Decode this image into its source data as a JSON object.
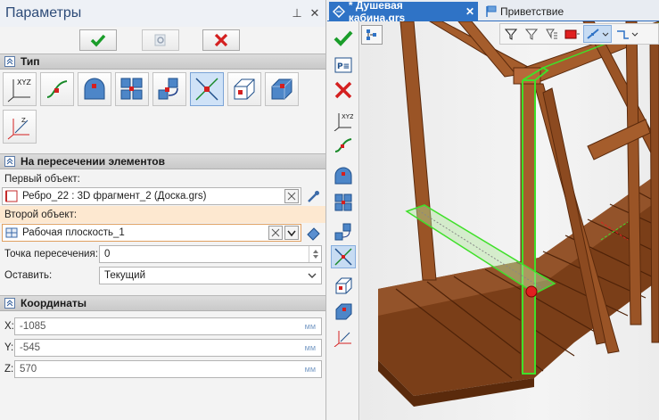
{
  "left_panel": {
    "title": "Параметры",
    "pin_glyph": "⊥",
    "close_glyph": "✕"
  },
  "sections": {
    "type": "Тип",
    "intersection": "На пересечении элементов",
    "coordinates": "Координаты"
  },
  "fields": {
    "first_object_label": "Первый объект:",
    "first_object_value": "Ребро_22 : 3D фрагмент_2 (Доска.grs)",
    "second_object_label": "Второй объект:",
    "second_object_value": "Рабочая плоскость_1",
    "intersection_point_label": "Точка пересечения:",
    "intersection_point_value": "0",
    "keep_label": "Оставить:",
    "keep_value": "Текущий"
  },
  "coordinates": {
    "x_label": "X:",
    "x_value": "-1085",
    "y_label": "Y:",
    "y_value": "-545",
    "z_label": "Z:",
    "z_value": "570",
    "unit": "мм"
  },
  "tabs": {
    "active": "* Душевая кабина.grs",
    "close": "✕",
    "inactive": "Приветствие"
  },
  "icons": {
    "ok": "check-icon",
    "preview": "preview-icon",
    "cancel": "cancel-icon"
  },
  "colors": {
    "accent": "#2f73c6",
    "ok_green": "#1a9d2a",
    "cancel_red": "#d42020",
    "wood": "#8b4a1f",
    "highlight": "#3fe02a",
    "section_highlight": "#fde8d0"
  }
}
